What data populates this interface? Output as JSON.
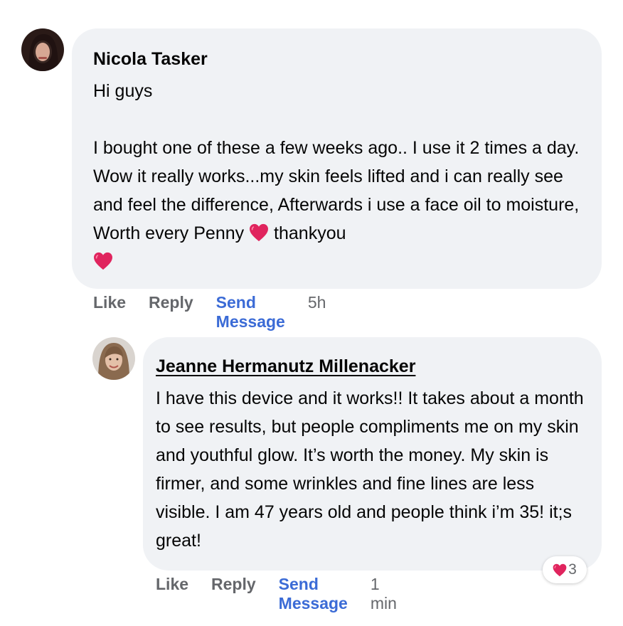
{
  "comments": [
    {
      "author": "Nicola Tasker",
      "paragraphs": [
        "Hi guys",
        "I bought one of these a few weeks ago.. I use it 2 times a day. Wow it really works...my skin feels lifted and i can really see and feel the difference, Afterwards i use a face oil to moisture, Worth every Penny",
        "thankyou"
      ],
      "actions": {
        "like": "Like",
        "reply": "Reply",
        "send_message": "Send Message",
        "time": "5h"
      },
      "avatar_icon": "profile-photo"
    },
    {
      "author": "Jeanne Hermanutz Millenacker",
      "text": "I have this device and it works!! It takes about a month to see results, but people compliments me on my skin and youthful glow. It’s worth the money. My skin is firmer, and some wrinkles and fine lines are less visible. I am 47 years old and people think i’m 35! it;s great!",
      "actions": {
        "like": "Like",
        "reply": "Reply",
        "send_message": "Send Message",
        "time": "1 min"
      },
      "reactions": {
        "icon": "heart-icon",
        "count": "3"
      },
      "avatar_icon": "profile-photo"
    }
  ],
  "colors": {
    "bubble": "#f0f2f5",
    "action_gray": "#65676b",
    "send_message_blue": "#3b6bd6",
    "heart_red": "#e0245e"
  }
}
